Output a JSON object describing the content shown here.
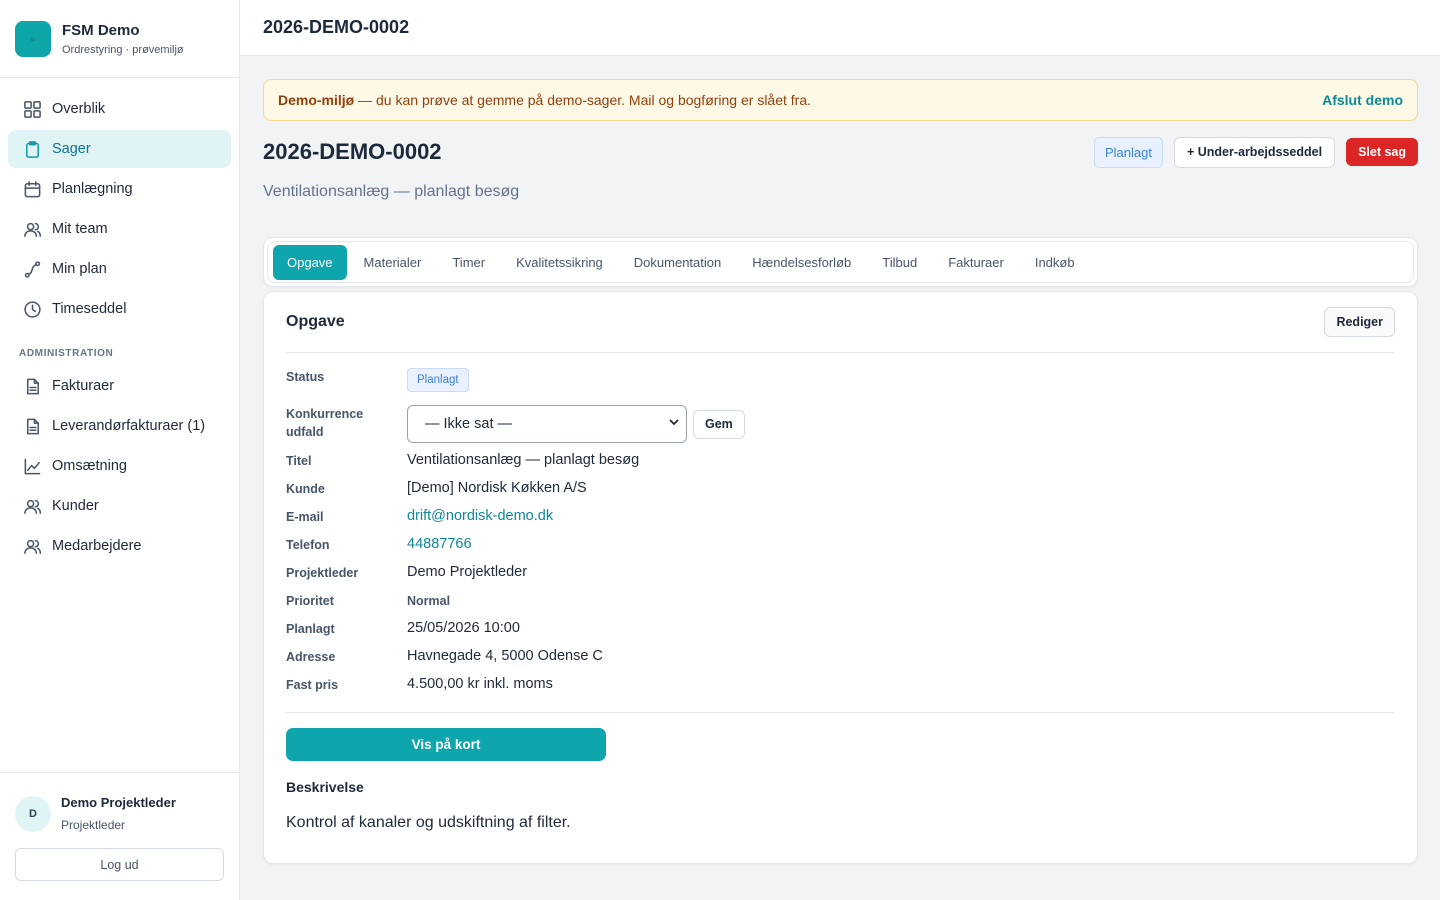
{
  "app": {
    "name": "FSM Demo",
    "subtitle": "Ordrestyring · prøvemiljø"
  },
  "sidebar": {
    "items": [
      {
        "label": "Overblik",
        "icon": "grid-icon"
      },
      {
        "label": "Sager",
        "icon": "clipboard-icon",
        "active": true
      },
      {
        "label": "Planlægning",
        "icon": "calendar-icon"
      },
      {
        "label": "Mit team",
        "icon": "users-icon"
      },
      {
        "label": "Min plan",
        "icon": "route-icon"
      },
      {
        "label": "Timeseddel",
        "icon": "clock-icon"
      }
    ],
    "admin_heading": "ADMINISTRATION",
    "admin_items": [
      {
        "label": "Fakturaer",
        "icon": "document-icon"
      },
      {
        "label": "Leverandørfakturaer (1)",
        "icon": "document-icon"
      },
      {
        "label": "Omsætning",
        "icon": "line-chart-icon"
      },
      {
        "label": "Kunder",
        "icon": "users-icon"
      },
      {
        "label": "Medarbejdere",
        "icon": "users-icon"
      }
    ]
  },
  "user": {
    "initial": "D",
    "name": "Demo Projektleder",
    "role": "Projektleder",
    "logout_label": "Log ud"
  },
  "topbar": {
    "title": "2026-DEMO-0002"
  },
  "banner": {
    "bold": "Demo-miljø",
    "text": " — du kan prøve at gemme på demo-sager. Mail og bogføring er slået fra.",
    "action": "Afslut demo"
  },
  "case": {
    "title": "2026-DEMO-0002",
    "subtitle": "Ventilationsanlæg — planlagt besøg",
    "status_label": "Planlagt",
    "sub_order_label": "+ Under-arbejdsseddel",
    "delete_label": "Slet sag"
  },
  "tabs": [
    "Opgave",
    "Materialer",
    "Timer",
    "Kvalitetssikring",
    "Dokumentation",
    "Hændelsesforløb",
    "Tilbud",
    "Fakturaer",
    "Indkøb"
  ],
  "task": {
    "heading": "Opgave",
    "edit_label": "Rediger",
    "fields": {
      "status": {
        "label": "Status",
        "value": "Planlagt"
      },
      "competition": {
        "label_1": "Konkurrence",
        "label_2": "udfald",
        "value": "— Ikke sat —",
        "save_label": "Gem"
      },
      "title": {
        "label": "Titel",
        "value": "Ventilationsanlæg — planlagt besøg"
      },
      "customer": {
        "label": "Kunde",
        "value": "[Demo] Nordisk Køkken A/S"
      },
      "email": {
        "label": "E-mail",
        "value": "drift@nordisk-demo.dk"
      },
      "phone": {
        "label": "Telefon",
        "value": "44887766"
      },
      "project_lead": {
        "label": "Projektleder",
        "value": "Demo Projektleder"
      },
      "priority": {
        "label": "Prioritet",
        "value": "Normal"
      },
      "planned": {
        "label": "Planlagt",
        "value": "25/05/2026 10:00"
      },
      "address": {
        "label": "Adresse",
        "value": "Havnegade 4, 5000 Odense C"
      },
      "fixed_price": {
        "label": "Fast pris",
        "value": "4.500,00 kr inkl. moms"
      }
    },
    "map_button": "Vis på kort",
    "description_heading": "Beskrivelse",
    "description": "Kontrol af kanaler og udskiftning af filter."
  },
  "colors": {
    "accent": "#0ea5ad",
    "danger": "#dc2626",
    "status_blue": "#3b82d6",
    "banner_bg": "#fef9e7"
  }
}
